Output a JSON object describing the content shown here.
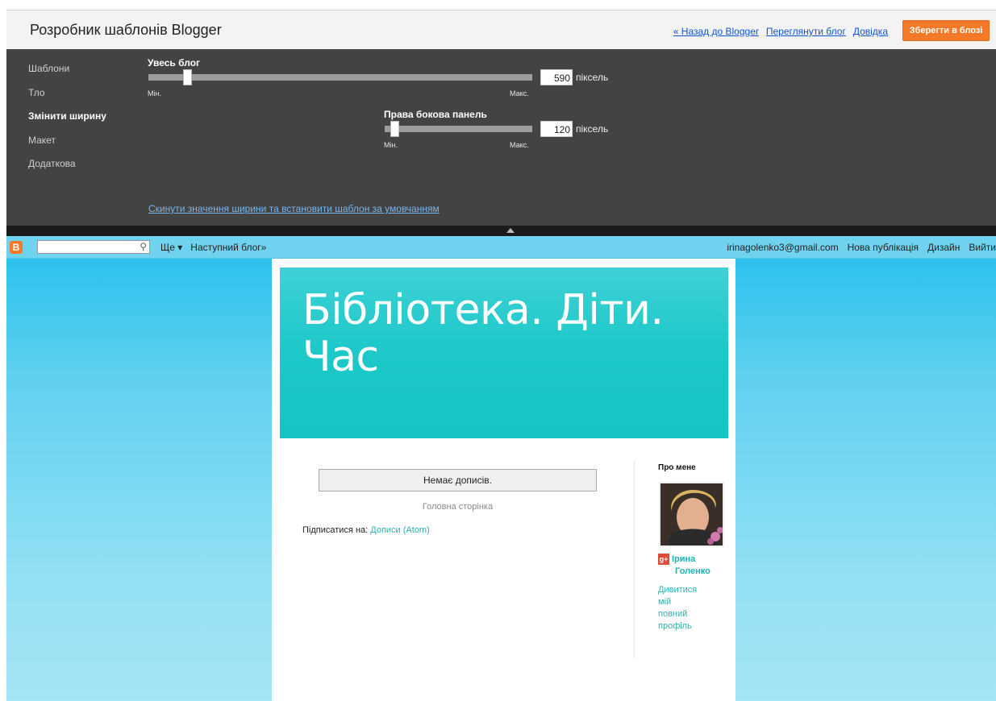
{
  "designer": {
    "title": "Розробник шаблонів Blogger",
    "links": [
      "« Назад до Blogger",
      "Переглянути блог",
      "Довідка"
    ],
    "save_label": "Зберегти в блозі",
    "accent": "#f47a2a"
  },
  "side_nav": {
    "items": [
      "Шаблони",
      "Тло",
      "Змінити ширину",
      "Макет",
      "Додаткова"
    ],
    "active": "Змінити ширину"
  },
  "width_controls": {
    "blog": {
      "label": "Увесь блог",
      "value": "590",
      "unit": "піксель",
      "min_label": "Мін.",
      "max_label": "Макс.",
      "fraction": 0.09
    },
    "sidebar": {
      "label": "Права бокова панель",
      "value": "120",
      "unit": "піксель",
      "min_label": "Мін.",
      "max_label": "Макс.",
      "fraction": 0.04
    },
    "reset_link": "Скинути значення ширини та встановити шаблон за умовчанням"
  },
  "navbar": {
    "search_placeholder": "",
    "more": "Ще ▾",
    "next_blog": "Наступний блог»",
    "email": "irinagolenko3@gmail.com",
    "new_post": "Нова публікація",
    "design": "Дизайн",
    "sign_out": "Вийти"
  },
  "blog": {
    "title_line1": "Бібліотека. Діти.",
    "title_line2": "Час",
    "no_posts": "Немає дописів.",
    "home": "Головна сторінка",
    "subscribe_label": "Підписатися на:",
    "subscribe_link": "Дописи (Atom)"
  },
  "about": {
    "title": "Про мене",
    "name_line1": "Ірина",
    "name_line2": "Голенко",
    "view_profile": [
      "Дивитися",
      "мій",
      "повний",
      "профіль"
    ]
  }
}
